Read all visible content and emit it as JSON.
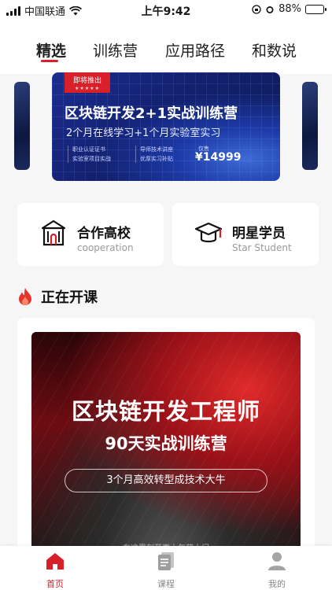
{
  "status_bar": {
    "carrier": "中国联通",
    "time": "上午9:42",
    "battery": "88%"
  },
  "tabs": [
    {
      "label": "精选",
      "active": true
    },
    {
      "label": "训练营",
      "active": false
    },
    {
      "label": "应用路径",
      "active": false
    },
    {
      "label": "和数说",
      "active": false
    }
  ],
  "banner": {
    "badge": "即将推出",
    "badge_stars": "★★★★★",
    "title": "区块链开发2+1实战训练营",
    "subtitle": "2个月在线学习+1个月实验室实习",
    "col1": [
      "职业认证证书",
      "实验室项目实战"
    ],
    "col2": [
      "导师技术讲座",
      "优厚实习补贴"
    ],
    "price_label": "仅售",
    "price": "¥14999"
  },
  "quick_cards": [
    {
      "title": "合作高校",
      "subtitle": "cooperation",
      "icon": "university-icon"
    },
    {
      "title": "明星学员",
      "subtitle": "Star Student",
      "icon": "graduation-cap-icon"
    }
  ],
  "section": {
    "title": "正在开课",
    "icon": "fire-icon"
  },
  "course": {
    "title": "区块链开发工程师",
    "subtitle": "90天实战训练营",
    "tagline": "3个月高效转型成技术大牛",
    "footer": "在这里刻开更大年薪大门"
  },
  "tabbar": [
    {
      "label": "首页",
      "icon": "home-icon",
      "active": true
    },
    {
      "label": "课程",
      "icon": "course-icon",
      "active": false
    },
    {
      "label": "我的",
      "icon": "profile-icon",
      "active": false
    }
  ],
  "colors": {
    "accent": "#d8202a",
    "inactive": "#9a9a9a"
  }
}
